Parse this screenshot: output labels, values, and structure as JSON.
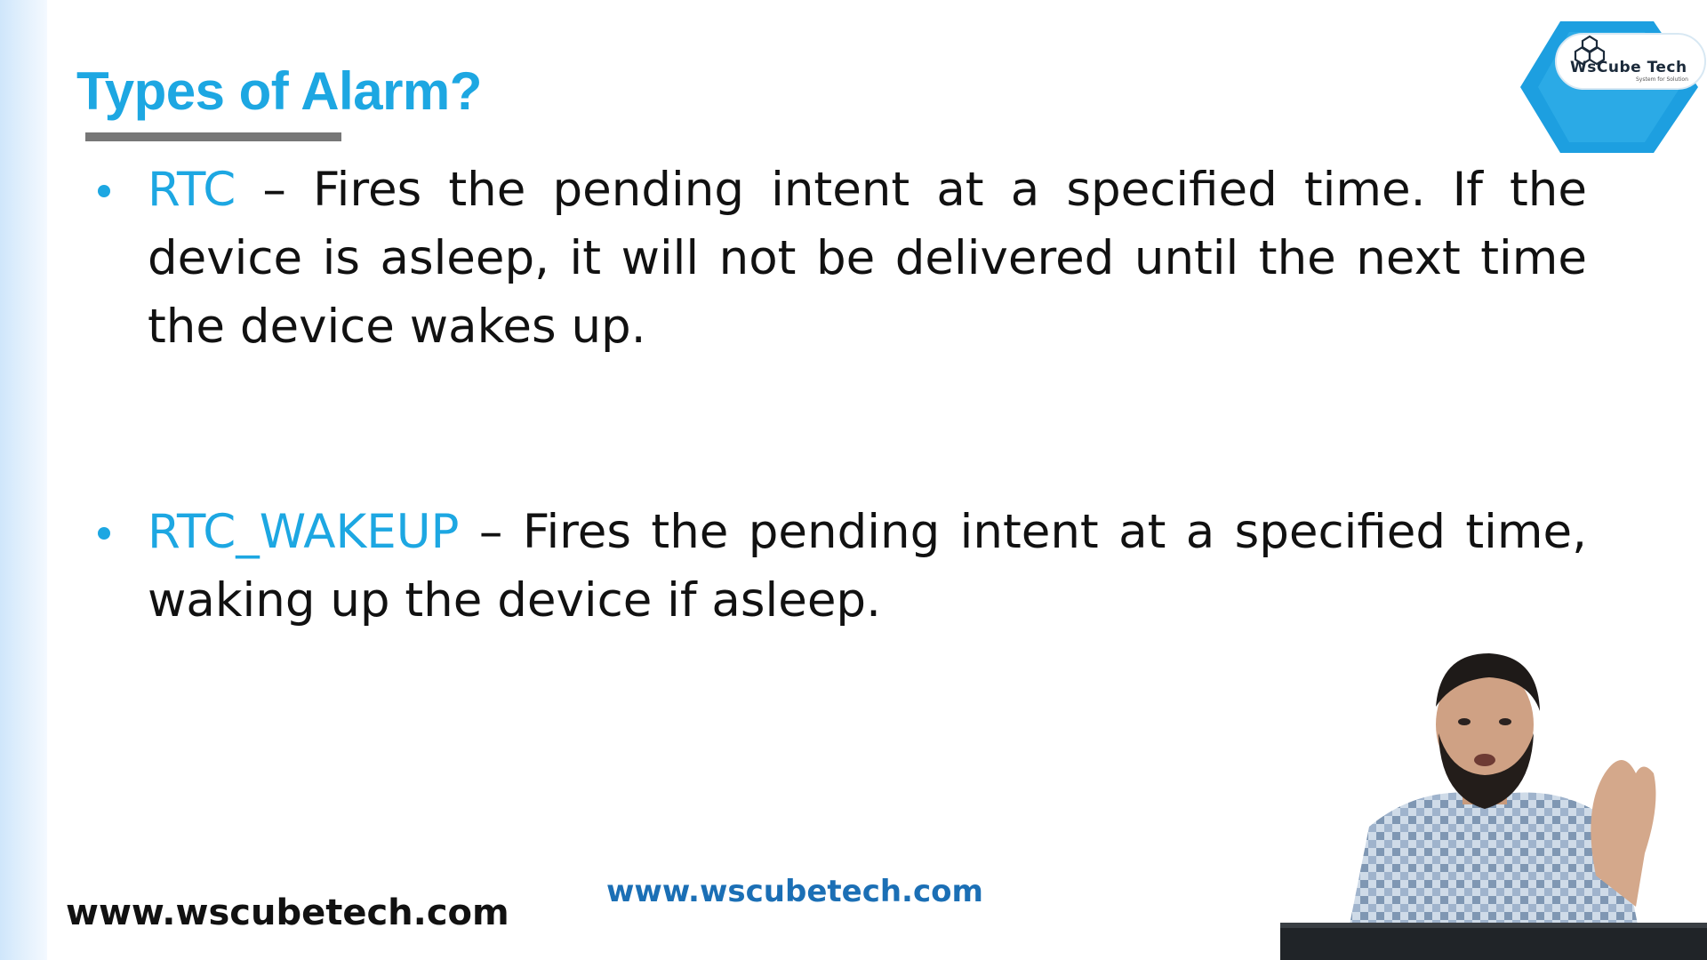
{
  "slide": {
    "title": "Types of Alarm?",
    "items": [
      {
        "term": "RTC",
        "separator": " – ",
        "description": "Fires the pending intent at a specified time. If the device is asleep, it will not be delivered until the next time the device wakes up."
      },
      {
        "term": "RTC_WAKEUP",
        "separator": " – ",
        "description": "Fires the pending intent at a specified time, waking up the device if asleep."
      }
    ]
  },
  "logo": {
    "name": "WsCube Tech",
    "tagline": "System for Solution"
  },
  "footer": {
    "url_left": "www.wscubetech.com",
    "url_center": "www.wscubetech.com"
  },
  "colors": {
    "accent": "#1da7e2",
    "text": "#111111",
    "underline": "#777777",
    "center_url": "#1b6fb5"
  }
}
